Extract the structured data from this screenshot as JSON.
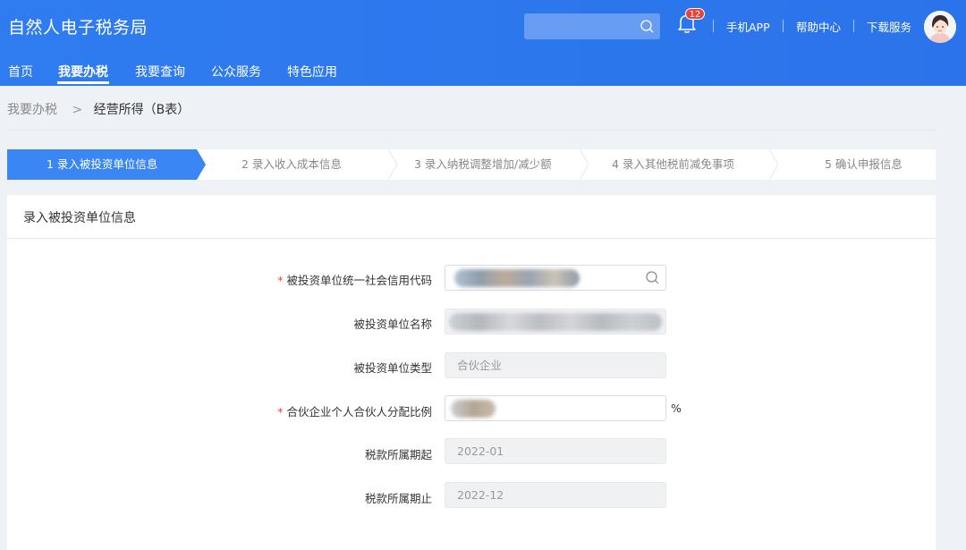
{
  "header": {
    "title": "自然人电子税务局",
    "search": {
      "value": ""
    },
    "notifications_count": "12",
    "links": [
      "手机APP",
      "帮助中心",
      "下载服务"
    ]
  },
  "nav": {
    "items": [
      "首页",
      "我要办税",
      "我要查询",
      "公众服务",
      "特色应用"
    ],
    "active": "我要办税"
  },
  "breadcrumb": {
    "root": "我要办税",
    "separator": ">",
    "current": "经营所得（B表）"
  },
  "steps": [
    {
      "label": "1  录入被投资单位信息",
      "active": true
    },
    {
      "label": "2  录入收入成本信息",
      "active": false
    },
    {
      "label": "3  录入纳税调整增加/减少额",
      "active": false
    },
    {
      "label": "4  录入其他税前减免事项",
      "active": false
    },
    {
      "label": "5  确认申报信息",
      "active": false
    }
  ],
  "form": {
    "title": "录入被投资单位信息",
    "required_mark": "*",
    "fields": [
      {
        "label": "被投资单位统一社会信用代码",
        "required": true,
        "value": ""
      },
      {
        "label": "被投资单位名称",
        "required": false,
        "value": ""
      },
      {
        "label": "被投资单位类型",
        "required": false,
        "value": "合伙企业"
      },
      {
        "label": "合伙企业个人合伙人分配比例",
        "required": true,
        "value": "",
        "suffix": "%"
      },
      {
        "label": "税款所属期起",
        "required": false,
        "value": "2022-01"
      },
      {
        "label": "税款所属期止",
        "required": false,
        "value": "2022-12"
      }
    ]
  },
  "colors": {
    "header_bg": "#2f7cf0",
    "step_active": "#3a86f4",
    "required": "#e8433a",
    "badge": "#e8433a"
  }
}
